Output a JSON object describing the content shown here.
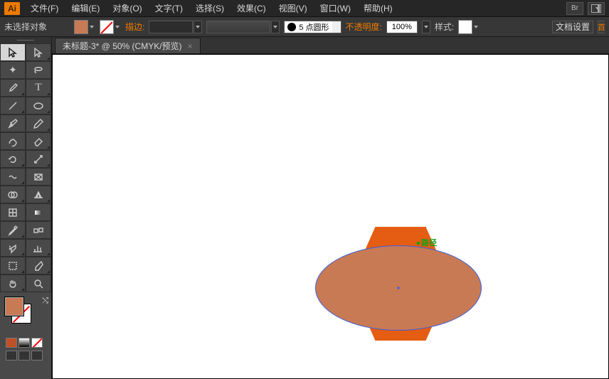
{
  "app": {
    "logo": "Ai"
  },
  "menu": {
    "file": "文件(F)",
    "edit": "编辑(E)",
    "object": "对象(O)",
    "type": "文字(T)",
    "select": "选择(S)",
    "effect": "效果(C)",
    "view": "视图(V)",
    "window": "窗口(W)",
    "help": "帮助(H)",
    "bridge": "Br"
  },
  "control": {
    "selection": "未选择对象",
    "stroke_label": "描边:",
    "stroke_profile": "5 点圆形",
    "opacity_label": "不透明度:",
    "opacity_value": "100%",
    "style_label": "样式:",
    "doc_setup": "文档设置",
    "pref_initial": "首"
  },
  "tab": {
    "title": "未标题-3* @ 50% (CMYK/预览)",
    "close": "×"
  },
  "canvas": {
    "path_label": "路径",
    "shapes": {
      "hexagon": {
        "fill": "#e55c13"
      },
      "ellipse": {
        "fill": "#c87a55",
        "stroke": "#3a5fdd"
      }
    }
  },
  "tools": {
    "row1": [
      "selection-tool",
      "direct-selection-tool"
    ],
    "row2": [
      "magic-wand-tool",
      "lasso-tool"
    ],
    "row3": [
      "pen-tool",
      "type-tool"
    ],
    "row4": [
      "line-segment-tool",
      "ellipse-tool"
    ],
    "row5": [
      "paintbrush-tool",
      "pencil-tool"
    ],
    "row6": [
      "blob-brush-tool",
      "eraser-tool"
    ],
    "row7": [
      "rotate-tool",
      "scale-tool"
    ],
    "row8": [
      "width-tool",
      "free-transform-tool"
    ],
    "row9": [
      "shape-builder-tool",
      "perspective-grid-tool"
    ],
    "row10": [
      "mesh-tool",
      "gradient-tool"
    ],
    "row11": [
      "eyedropper-tool",
      "blend-tool"
    ],
    "row12": [
      "symbol-sprayer-tool",
      "column-graph-tool"
    ],
    "row13": [
      "artboard-tool",
      "slice-tool"
    ],
    "row14": [
      "hand-tool",
      "zoom-tool"
    ]
  },
  "colors": {
    "fill": "#c87a55",
    "stroke": "none"
  }
}
